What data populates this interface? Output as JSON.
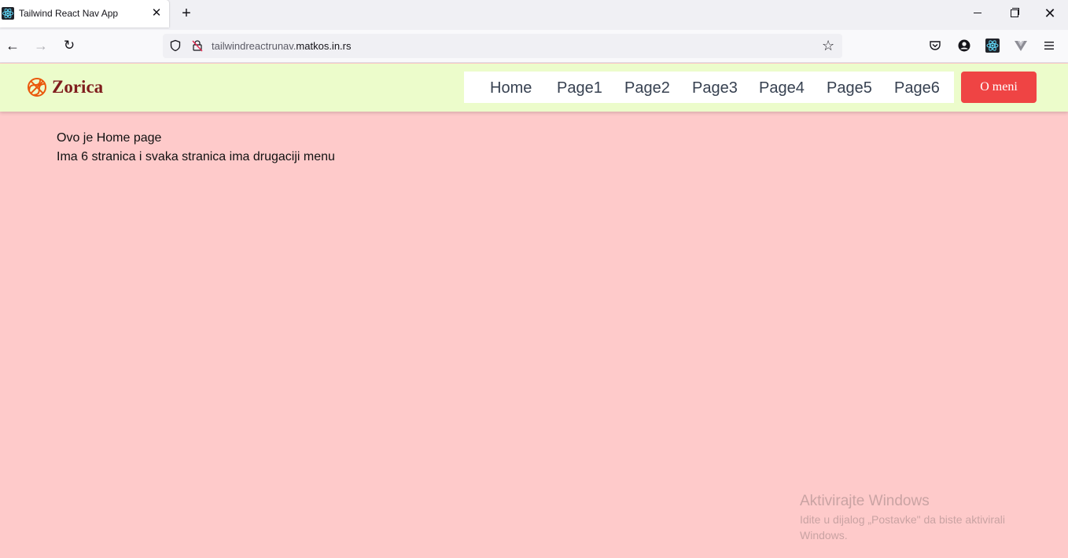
{
  "browser": {
    "tab_title": "Tailwind React Nav App",
    "tab_close": "✕",
    "new_tab": "+",
    "window_close": "✕",
    "url_prefix": "tailwindreactrunav.",
    "url_host": "matkos.in.rs",
    "back_glyph": "←",
    "forward_glyph": "→",
    "reload_glyph": "↻",
    "star_glyph": "☆"
  },
  "navbar": {
    "brand": "Zorica",
    "brand_color": "#7f1d1d",
    "bg_color": "#ecfccb",
    "menu": [
      "Home",
      "Page1",
      "Page2",
      "Page3",
      "Page4",
      "Page5",
      "Page6"
    ],
    "cta_label": "O meni",
    "cta_color": "#ef4444"
  },
  "content": {
    "line1": "Ovo je Home page",
    "line2": "Ima 6 stranica i svaka stranica ima drugaciji menu",
    "bg_color": "#fecaca"
  },
  "watermark": {
    "title": "Aktivirajte Windows",
    "text": "Idite u dijalog „Postavke\" da biste aktivirali Windows."
  }
}
